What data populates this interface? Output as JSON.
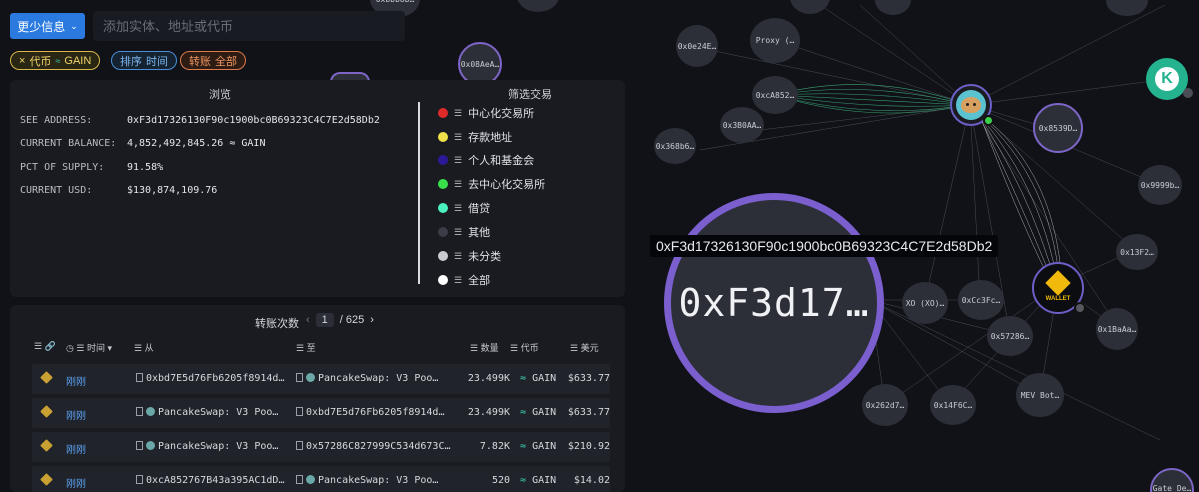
{
  "toolbar": {
    "more_info_label": "更少信息",
    "search_placeholder": "添加实体、地址或代币"
  },
  "chips": {
    "token": {
      "prefix": "×",
      "label": "代币",
      "value": "GAIN"
    },
    "sort": {
      "label": "排序",
      "value": "时间"
    },
    "transfer": {
      "label": "转账",
      "value": "全部"
    }
  },
  "browse": {
    "title": "浏览",
    "filter_title": "筛选交易",
    "rows": [
      {
        "label": "SEE ADDRESS:",
        "value": "0xF3d17326130F90c1900bc0B69323C4C7E2d58Db2"
      },
      {
        "label": "CURRENT BALANCE:",
        "value": "4,852,492,845.26 ≈ GAIN"
      },
      {
        "label": "PCT OF SUPPLY:",
        "value": "91.58%"
      },
      {
        "label": "CURRENT USD:",
        "value": "$130,874,109.76"
      }
    ],
    "filters": [
      {
        "label": "中心化交易所",
        "color": "#e02a2a"
      },
      {
        "label": "存款地址",
        "color": "#f0e04a"
      },
      {
        "label": "个人和基金会",
        "color": "#2a1a9a"
      },
      {
        "label": "去中心化交易所",
        "color": "#3ae04a"
      },
      {
        "label": "借贷",
        "color": "#4af0c0"
      },
      {
        "label": "其他",
        "color": "#3a3d45"
      },
      {
        "label": "未分类",
        "color": "#c8cad0"
      },
      {
        "label": "全部",
        "color": "#ffffff"
      }
    ]
  },
  "transfers": {
    "title": "转账次数",
    "page": "1",
    "total_pages": "/ 625",
    "headers": {
      "time": "时间",
      "from": "从",
      "to": "至",
      "amount": "数量",
      "token": "代币",
      "usd": "美元"
    },
    "rows": [
      {
        "time": "刚刚",
        "from": "0xbd7E5d76Fb6205f8914d…",
        "to": "PancakeSwap: V3 Poo…",
        "amount": "23.499K",
        "token": "GAIN",
        "usd": "$633.77"
      },
      {
        "time": "刚刚",
        "from": "PancakeSwap: V3 Poo…",
        "to": "0xbd7E5d76Fb6205f8914d…",
        "amount": "23.499K",
        "token": "GAIN",
        "usd": "$633.77"
      },
      {
        "time": "刚刚",
        "from": "PancakeSwap: V3 Poo…",
        "to": "0x57286C827999C534d673C…",
        "amount": "7.82K",
        "token": "GAIN",
        "usd": "$210.92"
      },
      {
        "time": "刚刚",
        "from": "0xcA852767B43a395AC1dD…",
        "to": "PancakeSwap: V3 Poo…",
        "amount": "520",
        "token": "GAIN",
        "usd": "$14.02"
      }
    ]
  },
  "graph": {
    "main_node_label": "0xF3d17…",
    "main_node_tooltip": "0xF3d17326130F90c1900bc0B69323C4C7E2d58Db2",
    "wallet_label": "WALLET",
    "nodes": [
      "0xbbb8b…",
      "0x08AeA…",
      "0x0e24E…",
      "Proxy (…",
      "0xcA852…",
      "0x3B0AA…",
      "0x368b6…",
      "0x8539D…",
      "0x9999b…",
      "0x13F2…",
      "XO (XO)…",
      "0xCc3Fc…",
      "0x57286…",
      "0x1BaAa…",
      "0x262d7…",
      "0x14F6C…",
      "MEV Bot…",
      "Gate De…"
    ]
  }
}
